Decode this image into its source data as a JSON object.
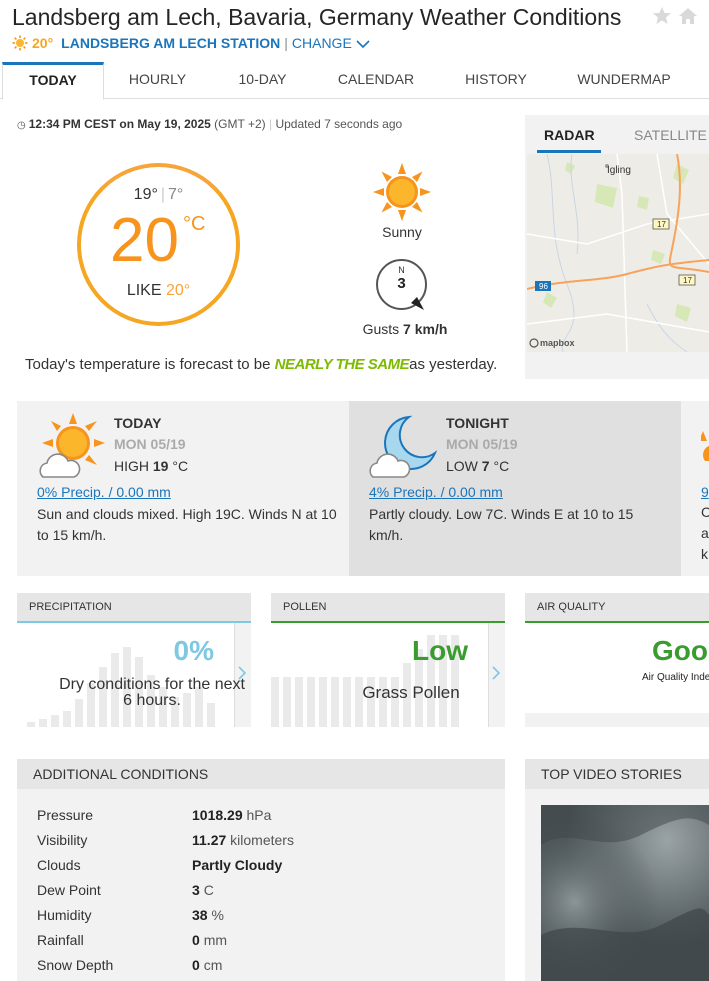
{
  "header": {
    "title": "Landsberg am Lech, Bavaria, Germany Weather Conditions",
    "current_temp": "20°",
    "station": "LANDSBERG AM LECH STATION",
    "separator": "|",
    "change_label": "CHANGE"
  },
  "tabs": [
    "TODAY",
    "HOURLY",
    "10-DAY",
    "CALENDAR",
    "HISTORY",
    "WUNDERMAP"
  ],
  "current": {
    "time": "12:34 PM CEST on May 19, 2025",
    "timezone": "(GMT +2)",
    "updated": "Updated 7 seconds ago",
    "high": "19°",
    "low": "7°",
    "temp": "20",
    "unit": "°C",
    "like_label": "LIKE",
    "like_value": "20°",
    "condition": "Sunny",
    "wind_dir": "N",
    "wind_speed": "3",
    "gusts_label": "Gusts",
    "gusts_value": "7 km/h",
    "forecast_pre": "Today's temperature is forecast to be",
    "forecast_highlight": "NEARLY THE SAME",
    "forecast_post": "as yesterday."
  },
  "radar": {
    "tab_radar": "RADAR",
    "tab_satellite": "SATELLITE",
    "town": "Igling",
    "road_17a": "17",
    "road_17b": "17",
    "road_96": "96",
    "mapbox": "mapbox"
  },
  "forecast": {
    "today": {
      "label": "TODAY",
      "date": "MON 05/19",
      "hilo_label": "HIGH",
      "hilo_value": "19",
      "hilo_unit": "°C",
      "precip": "0% Precip. / 0.00 mm",
      "desc": "Sun and clouds mixed. High 19C. Winds N at 10 to 15 km/h."
    },
    "tonight": {
      "label": "TONIGHT",
      "date": "MON 05/19",
      "hilo_label": "LOW",
      "hilo_value": "7",
      "hilo_unit": "°C",
      "precip": "4% Precip. / 0.00 mm",
      "desc": "Partly cloudy. Low 7C. Winds E at 10 to 15 km/h."
    },
    "next": {
      "precip": "9",
      "desc_1": "C",
      "desc_2": "a",
      "desc_3": "k"
    }
  },
  "tiles": {
    "precip": {
      "title": "PRECIPITATION",
      "value": "0%",
      "text": "Dry conditions for the next 6 hours."
    },
    "pollen": {
      "title": "POLLEN",
      "value": "Low",
      "text": "Grass Pollen"
    },
    "aq": {
      "title": "AIR QUALITY",
      "value": "Good",
      "text": "Air Quality Index"
    }
  },
  "additional": {
    "title": "ADDITIONAL CONDITIONS",
    "rows": [
      {
        "label": "Pressure",
        "value": "1018.29",
        "unit": "hPa"
      },
      {
        "label": "Visibility",
        "value": "11.27",
        "unit": "kilometers"
      },
      {
        "label": "Clouds",
        "value": "Partly Cloudy",
        "unit": ""
      },
      {
        "label": "Dew Point",
        "value": "3",
        "unit": "C"
      },
      {
        "label": "Humidity",
        "value": "38",
        "unit": "%"
      },
      {
        "label": "Rainfall",
        "value": "0",
        "unit": "mm"
      },
      {
        "label": "Snow Depth",
        "value": "0",
        "unit": "cm"
      }
    ]
  },
  "video": {
    "title": "TOP VIDEO STORIES"
  },
  "colors": {
    "accent_blue": "#1b75bb",
    "temp_orange": "#f7941d",
    "highlight_green": "#7cbb00",
    "precip_blue": "#7ec8e3",
    "pollen_green": "#3a9c2f",
    "aq_green": "#3a9c2f"
  }
}
